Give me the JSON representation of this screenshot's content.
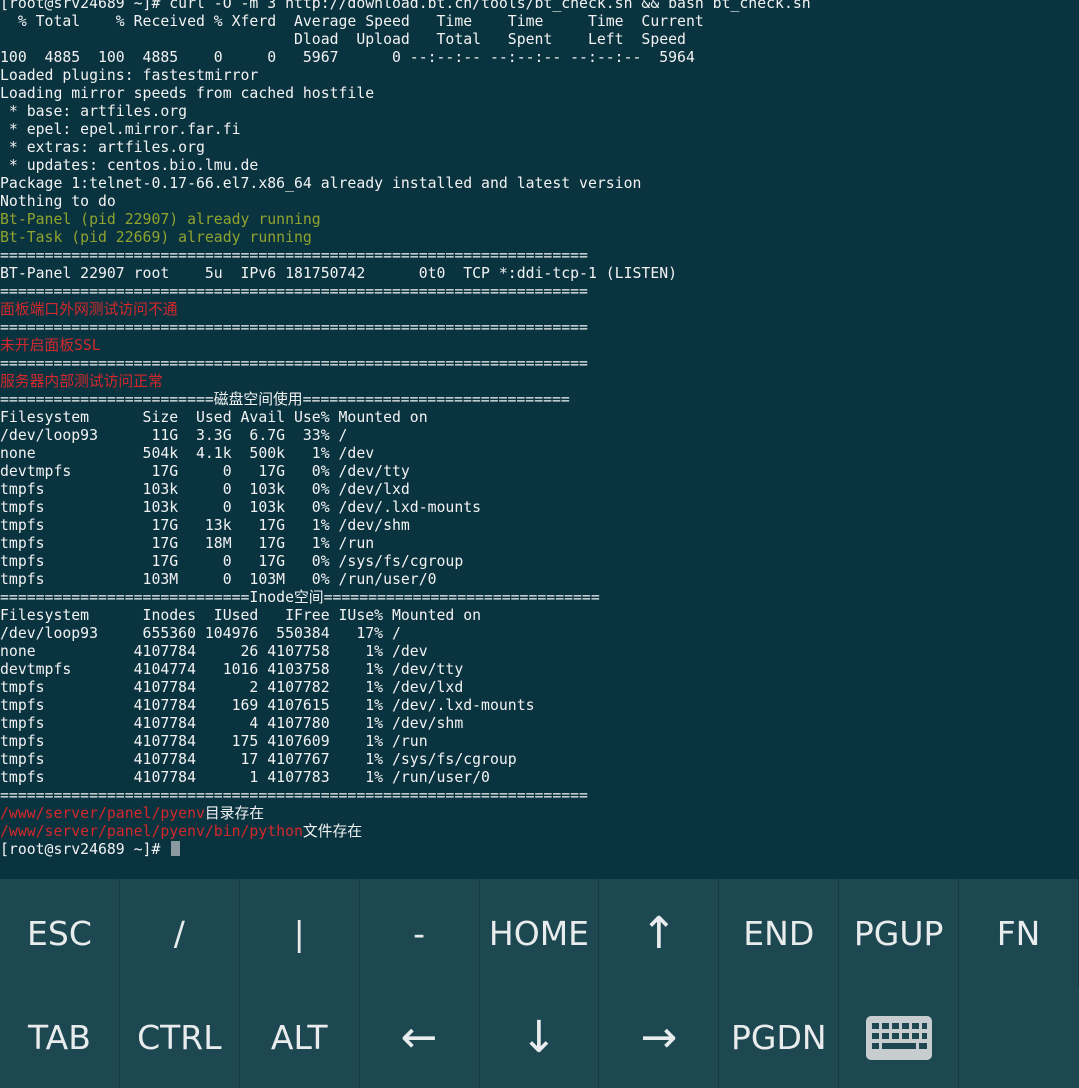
{
  "terminal": {
    "lines": [
      [
        {
          "text": "[root@srv24689 ~]# curl -O -m 3 http://download.bt.cn/tools/bt_check.sh && bash bt_check.sh",
          "color": "default"
        }
      ],
      [
        {
          "text": "  % Total    % Received % Xferd  Average Speed   Time    Time     Time  Current",
          "color": "default"
        }
      ],
      [
        {
          "text": "                                 Dload  Upload   Total   Spent    Left  Speed",
          "color": "default"
        }
      ],
      [
        {
          "text": "100  4885  100  4885    0     0   5967      0 --:--:-- --:--:-- --:--:--  5964",
          "color": "default"
        }
      ],
      [
        {
          "text": "Loaded plugins: fastestmirror",
          "color": "default"
        }
      ],
      [
        {
          "text": "Loading mirror speeds from cached hostfile",
          "color": "default"
        }
      ],
      [
        {
          "text": " * base: artfiles.org",
          "color": "default"
        }
      ],
      [
        {
          "text": " * epel: epel.mirror.far.fi",
          "color": "default"
        }
      ],
      [
        {
          "text": " * extras: artfiles.org",
          "color": "default"
        }
      ],
      [
        {
          "text": " * updates: centos.bio.lmu.de",
          "color": "default"
        }
      ],
      [
        {
          "text": "Package 1:telnet-0.17-66.el7.x86_64 already installed and latest version",
          "color": "default"
        }
      ],
      [
        {
          "text": "Nothing to do",
          "color": "default"
        }
      ],
      [
        {
          "text": "Bt-Panel (pid 22907) already running",
          "color": "green"
        }
      ],
      [
        {
          "text": "Bt-Task (pid 22669) already running",
          "color": "green"
        }
      ],
      [
        {
          "text": "==================================================================",
          "color": "default"
        }
      ],
      [
        {
          "text": "BT-Panel 22907 root    5u  IPv6 181750742      0t0  TCP *:ddi-tcp-1 (LISTEN)",
          "color": "default"
        }
      ],
      [
        {
          "text": "==================================================================",
          "color": "default"
        }
      ],
      [
        {
          "text": "面板端口外网测试访问不通",
          "color": "red"
        }
      ],
      [
        {
          "text": "==================================================================",
          "color": "default"
        }
      ],
      [
        {
          "text": "未开启面板SSL",
          "color": "red"
        }
      ],
      [
        {
          "text": "==================================================================",
          "color": "default"
        }
      ],
      [
        {
          "text": "服务器内部测试访问正常",
          "color": "red"
        }
      ],
      [
        {
          "text": "========================磁盘空间使用==============================",
          "color": "default"
        }
      ],
      [
        {
          "text": "Filesystem      Size  Used Avail Use% Mounted on",
          "color": "default"
        }
      ],
      [
        {
          "text": "/dev/loop93      11G  3.3G  6.7G  33% /",
          "color": "default"
        }
      ],
      [
        {
          "text": "none            504k  4.1k  500k   1% /dev",
          "color": "default"
        }
      ],
      [
        {
          "text": "devtmpfs         17G     0   17G   0% /dev/tty",
          "color": "default"
        }
      ],
      [
        {
          "text": "tmpfs           103k     0  103k   0% /dev/lxd",
          "color": "default"
        }
      ],
      [
        {
          "text": "tmpfs           103k     0  103k   0% /dev/.lxd-mounts",
          "color": "default"
        }
      ],
      [
        {
          "text": "tmpfs            17G   13k   17G   1% /dev/shm",
          "color": "default"
        }
      ],
      [
        {
          "text": "tmpfs            17G   18M   17G   1% /run",
          "color": "default"
        }
      ],
      [
        {
          "text": "tmpfs            17G     0   17G   0% /sys/fs/cgroup",
          "color": "default"
        }
      ],
      [
        {
          "text": "tmpfs           103M     0  103M   0% /run/user/0",
          "color": "default"
        }
      ],
      [
        {
          "text": "============================Inode空间===============================",
          "color": "default"
        }
      ],
      [
        {
          "text": "Filesystem      Inodes  IUsed   IFree IUse% Mounted on",
          "color": "default"
        }
      ],
      [
        {
          "text": "/dev/loop93     655360 104976  550384   17% /",
          "color": "default"
        }
      ],
      [
        {
          "text": "none           4107784     26 4107758    1% /dev",
          "color": "default"
        }
      ],
      [
        {
          "text": "devtmpfs       4104774   1016 4103758    1% /dev/tty",
          "color": "default"
        }
      ],
      [
        {
          "text": "tmpfs          4107784      2 4107782    1% /dev/lxd",
          "color": "default"
        }
      ],
      [
        {
          "text": "tmpfs          4107784    169 4107615    1% /dev/.lxd-mounts",
          "color": "default"
        }
      ],
      [
        {
          "text": "tmpfs          4107784      4 4107780    1% /dev/shm",
          "color": "default"
        }
      ],
      [
        {
          "text": "tmpfs          4107784    175 4107609    1% /run",
          "color": "default"
        }
      ],
      [
        {
          "text": "tmpfs          4107784     17 4107767    1% /sys/fs/cgroup",
          "color": "default"
        }
      ],
      [
        {
          "text": "tmpfs          4107784      1 4107783    1% /run/user/0",
          "color": "default"
        }
      ],
      [
        {
          "text": "==================================================================",
          "color": "default"
        }
      ],
      [
        {
          "text": "/www/server/panel/pyenv",
          "color": "red"
        },
        {
          "text": "目录存在",
          "color": "default"
        }
      ],
      [
        {
          "text": "/www/server/panel/pyenv/bin/python",
          "color": "red"
        },
        {
          "text": "文件存在",
          "color": "default"
        }
      ],
      [
        {
          "text": "[root@srv24689 ~]# ",
          "color": "default"
        }
      ]
    ],
    "cursor_line": 47
  },
  "extra_keys": {
    "row1": [
      {
        "label": "ESC",
        "name": "esc-key",
        "arrow": false
      },
      {
        "label": "/",
        "name": "slash-key",
        "arrow": false
      },
      {
        "label": "|",
        "name": "pipe-key",
        "arrow": false
      },
      {
        "label": "-",
        "name": "dash-key",
        "arrow": false
      },
      {
        "label": "HOME",
        "name": "home-key",
        "arrow": false
      },
      {
        "label": "↑",
        "name": "up-arrow-key",
        "arrow": true
      },
      {
        "label": "END",
        "name": "end-key",
        "arrow": false
      },
      {
        "label": "PGUP",
        "name": "pgup-key",
        "arrow": false
      },
      {
        "label": "FN",
        "name": "fn-key",
        "arrow": false
      }
    ],
    "row2": [
      {
        "label": "TAB",
        "name": "tab-key",
        "arrow": false
      },
      {
        "label": "CTRL",
        "name": "ctrl-key",
        "arrow": false
      },
      {
        "label": "ALT",
        "name": "alt-key",
        "arrow": false
      },
      {
        "label": "←",
        "name": "left-arrow-key",
        "arrow": true
      },
      {
        "label": "↓",
        "name": "down-arrow-key",
        "arrow": true
      },
      {
        "label": "→",
        "name": "right-arrow-key",
        "arrow": true
      },
      {
        "label": "PGDN",
        "name": "pgdn-key",
        "arrow": false
      }
    ],
    "keyboard_icon": "keyboard-icon"
  },
  "colors": {
    "background": "#0a3340",
    "text": "#f2f2f2",
    "green": "#8fa32e",
    "red": "#d2282b",
    "keybar": "#1d4751"
  }
}
